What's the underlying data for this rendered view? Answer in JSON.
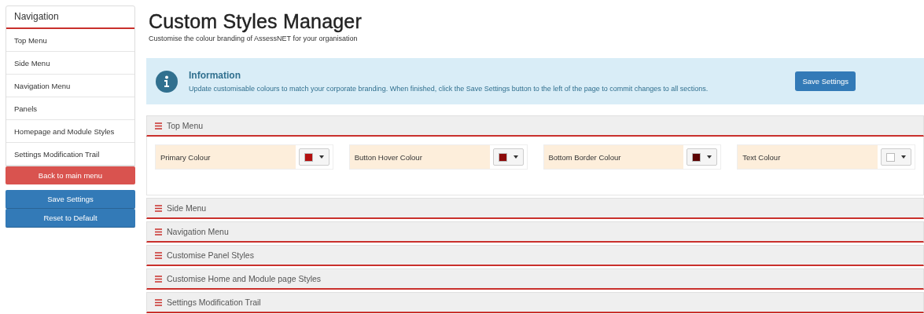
{
  "sidebar": {
    "title": "Navigation",
    "items": [
      {
        "label": "Top Menu"
      },
      {
        "label": "Side Menu"
      },
      {
        "label": "Navigation Menu"
      },
      {
        "label": "Panels"
      },
      {
        "label": "Homepage and Module Styles"
      },
      {
        "label": "Settings Modification Trail"
      }
    ],
    "buttons": [
      {
        "label": "Back to main menu",
        "kind": "danger"
      },
      {
        "label": "Save Settings",
        "kind": "primary"
      },
      {
        "label": "Reset to Default",
        "kind": "primary"
      }
    ]
  },
  "header": {
    "title": "Custom Styles Manager",
    "subtitle": "Customise the colour branding of AssessNET for your organisation"
  },
  "info": {
    "title": "Information",
    "text": "Update customisable colours to match your corporate branding. When finished, click the Save Settings button to the left of the page to commit changes to all sections.",
    "button": "Save Settings"
  },
  "sections": [
    {
      "title": "Top Menu",
      "fields": [
        {
          "label": "Primary Colour",
          "color": "#b30f0f"
        },
        {
          "label": "Button Hover Colour",
          "color": "#8c0a0a"
        },
        {
          "label": "Bottom Border Colour",
          "color": "#5c0505"
        },
        {
          "label": "Text Colour",
          "color": "#ffffff"
        }
      ]
    },
    {
      "title": "Side Menu"
    },
    {
      "title": "Navigation Menu"
    },
    {
      "title": "Customise Panel Styles"
    },
    {
      "title": "Customise Home and Module page Styles"
    },
    {
      "title": "Settings Modification Trail"
    }
  ]
}
